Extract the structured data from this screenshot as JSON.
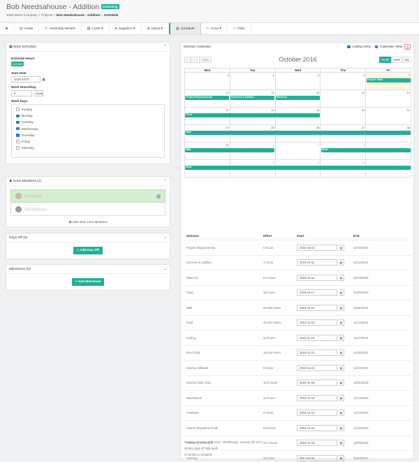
{
  "header": {
    "title": "Bob Needsahouse - Addition",
    "status_badge": "Estimating",
    "breadcrumbs": [
      "4360 Demo Company",
      "/",
      "Projects",
      "/",
      "Bob Needsahouse - Addition",
      "/",
      "Schedule"
    ]
  },
  "nav": {
    "items": [
      {
        "label": "",
        "icon": "dashboard-icon",
        "glyph": "◙"
      },
      {
        "label": "Areas",
        "icon": "areas-icon",
        "glyph": "▤"
      },
      {
        "label": "Assembly Wizard",
        "icon": "wand-icon",
        "glyph": "✎"
      },
      {
        "label": "Costs ▾",
        "icon": "costs-icon",
        "glyph": "▦"
      },
      {
        "label": "Suppliers ▾",
        "icon": "suppliers-icon",
        "glyph": "♣"
      },
      {
        "label": "Client ▾",
        "icon": "client-icon",
        "glyph": "♟"
      },
      {
        "label": "Schedule",
        "icon": "schedule-icon",
        "glyph": "▦",
        "active": true
      },
      {
        "label": "Crew ▾",
        "icon": "crew-icon",
        "glyph": "✄"
      },
      {
        "label": "Files",
        "icon": "files-icon",
        "glyph": "▭"
      }
    ]
  },
  "work_schedule": {
    "title": "Work Schedule",
    "estimate_hours_label": "Estimate Hours",
    "estimate_hours": "343.893",
    "start_date_label": "Start Date",
    "start_date": "2016-10-07",
    "hours_day_label": "Work Hours/Day",
    "hours_day": "8",
    "hours_unit": "Hours",
    "work_days_label": "Work Days",
    "days": [
      {
        "label": "Sunday",
        "checked": false
      },
      {
        "label": "Monday",
        "checked": true
      },
      {
        "label": "Tuesday",
        "checked": true
      },
      {
        "label": "Wednesday",
        "checked": true
      },
      {
        "label": "Thursday",
        "checked": true
      },
      {
        "label": "Friday",
        "checked": false
      },
      {
        "label": "Saturday",
        "checked": false
      }
    ]
  },
  "crew": {
    "title": "Crew Members (1)",
    "members": [
      "Gus Ispuelle",
      "Elsy Olmebriom"
    ],
    "invite": "Invite More Crew Members"
  },
  "days_off": {
    "title": "Days Off (0)",
    "button": "Add Day Off"
  },
  "milestones": {
    "title": "Milestones (0)",
    "button": "Add Milestone"
  },
  "calendar": {
    "title": "Division Calendar",
    "listing_view": "Listing View",
    "calendar_view": "Calendar View",
    "month_title": "October 2016",
    "today": "today",
    "prev": "‹",
    "next": "›",
    "view_buttons": [
      "month",
      "week",
      "day"
    ],
    "dow": [
      "Mon",
      "Tue",
      "Wed",
      "Thu",
      "Fri"
    ],
    "weeks": [
      [
        "3",
        "4",
        "5",
        "6",
        "7"
      ],
      [
        "10",
        "11",
        "12",
        "13",
        "14"
      ],
      [
        "17",
        "18",
        "19",
        "20",
        "21"
      ],
      [
        "24",
        "25",
        "26",
        "27",
        "28"
      ],
      [
        "31",
        "1",
        "2",
        "3",
        "4"
      ],
      [
        "7",
        "8",
        "9",
        "10",
        "11"
      ]
    ],
    "events": [
      {
        "label": "Project Start",
        "week": 0,
        "start": 4,
        "span": 1
      },
      {
        "label": "Project Requirements",
        "week": 1,
        "start": 0,
        "span": 1
      },
      {
        "label": "Services & Utilities",
        "week": 1,
        "start": 1,
        "span": 1
      },
      {
        "label": "Masonry",
        "week": 1,
        "start": 2,
        "span": 1
      },
      {
        "label": "Floor",
        "week": 2,
        "start": 0,
        "span": 3
      },
      {
        "label": "Wall",
        "week": 3,
        "start": 0,
        "span": 5
      },
      {
        "label": "Wall",
        "week": 4,
        "start": 0,
        "span": 2
      },
      {
        "label": "Roof",
        "week": 4,
        "start": 3,
        "span": 2
      },
      {
        "label": "Roof",
        "week": 5,
        "start": 0,
        "span": 5
      }
    ]
  },
  "divisions": {
    "headers": [
      "Division",
      "Effort",
      "Start",
      "End"
    ],
    "rows": [
      {
        "division": "Project Requirements",
        "effort": "0 hours",
        "start": "2016-10-10",
        "end": "10/10/2016"
      },
      {
        "division": "Services & Utilities",
        "effort": "1 hours",
        "start": "2016-10-11",
        "end": "10/11/2016"
      },
      {
        "division": "Masonry",
        "effort": "8.1 hours",
        "start": "2016-10-12",
        "end": "10/13/2016"
      },
      {
        "division": "Floor",
        "effort": "28 hours",
        "start": "2016-10-17",
        "end": "10/20/2016"
      },
      {
        "division": "Wall",
        "effort": "54.060 hours",
        "start": "2016-10-24",
        "end": "11/02/2016"
      },
      {
        "division": "Roof",
        "effort": "45.247 hours",
        "start": "2016-11-03",
        "end": "11/14/2016"
      },
      {
        "division": "Ceiling",
        "effort": "22 hours",
        "start": "2016-11-15",
        "end": "11/17/2016"
      },
      {
        "division": "Roof Clad",
        "effort": "18.240 hours",
        "start": "2016-11-21",
        "end": "11/23/2016"
      },
      {
        "division": "Exterior Millwork",
        "effort": "8 hours",
        "start": "2016-11-24",
        "end": "11/24/2016"
      },
      {
        "division": "Exterior Wall Clad",
        "effort": "10.2 hours",
        "start": "2016-11-28",
        "end": "12/01/2016"
      },
      {
        "division": "Mechanical",
        "effort": "22 hours",
        "start": "2016-12-13",
        "end": "12/13/2016"
      },
      {
        "division": "Insulation",
        "effort": "0 hours",
        "start": "2016-12-14",
        "end": "12/14/2016"
      },
      {
        "division": "Interior Drywall & Finish",
        "effort": "5.6 hours",
        "start": "2016-12-15",
        "end": "12/15/2016"
      },
      {
        "division": "Cabinetry & Closets",
        "effort": "62.4 hours",
        "start": "2016-12-19",
        "end": "12/29/2016"
      },
      {
        "division": "Flooring",
        "effort": "24 hours",
        "start": "2017-01-02",
        "end": "01/04/2017"
      }
    ]
  },
  "summary": {
    "range": "Monday, October 10th 2016 - Wednesday, January 4th 2017",
    "days": "42.851 days of Total Work",
    "months": "3 months to complete"
  }
}
